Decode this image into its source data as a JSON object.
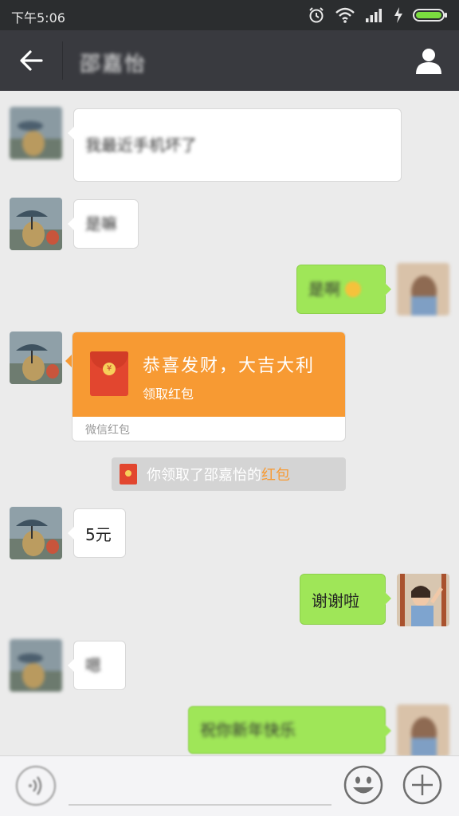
{
  "status_bar": {
    "time": "下午5:06",
    "icons": [
      "alarm-icon",
      "wifi-icon",
      "signal-icon",
      "charging-icon",
      "battery-icon"
    ]
  },
  "header": {
    "title": "邵嘉怡",
    "back_icon": "arrow-left-icon",
    "profile_icon": "person-icon"
  },
  "messages": [
    {
      "side": "left",
      "text": "我最近手机坏了",
      "blurred": true
    },
    {
      "side": "left",
      "text": "是嘛",
      "blurred": true
    },
    {
      "side": "right",
      "text": "是啊",
      "blurred": true
    },
    {
      "side": "left",
      "type": "red_packet",
      "title": "恭喜发财，大吉大利",
      "subtitle": "领取红包",
      "footer": "微信红包"
    },
    {
      "type": "system_notice",
      "text_prefix": "你领取了邵嘉怡的",
      "highlight": "红包"
    },
    {
      "side": "left",
      "text": "5元",
      "blurred": false
    },
    {
      "side": "right",
      "text": "谢谢啦",
      "blurred": false
    },
    {
      "side": "left",
      "text": "嗯",
      "blurred": true
    },
    {
      "side": "right",
      "text": "祝你新年快乐",
      "blurred": true
    }
  ],
  "bottom_bar": {
    "voice_icon": "voice-icon",
    "emoji_icon": "emoji-icon",
    "plus_icon": "plus-icon"
  },
  "colors": {
    "header_bg": "#393a3f",
    "chat_bg": "#ebebeb",
    "right_bubble": "#9fe658",
    "red_packet": "#f79a33",
    "highlight": "#f79a33"
  }
}
